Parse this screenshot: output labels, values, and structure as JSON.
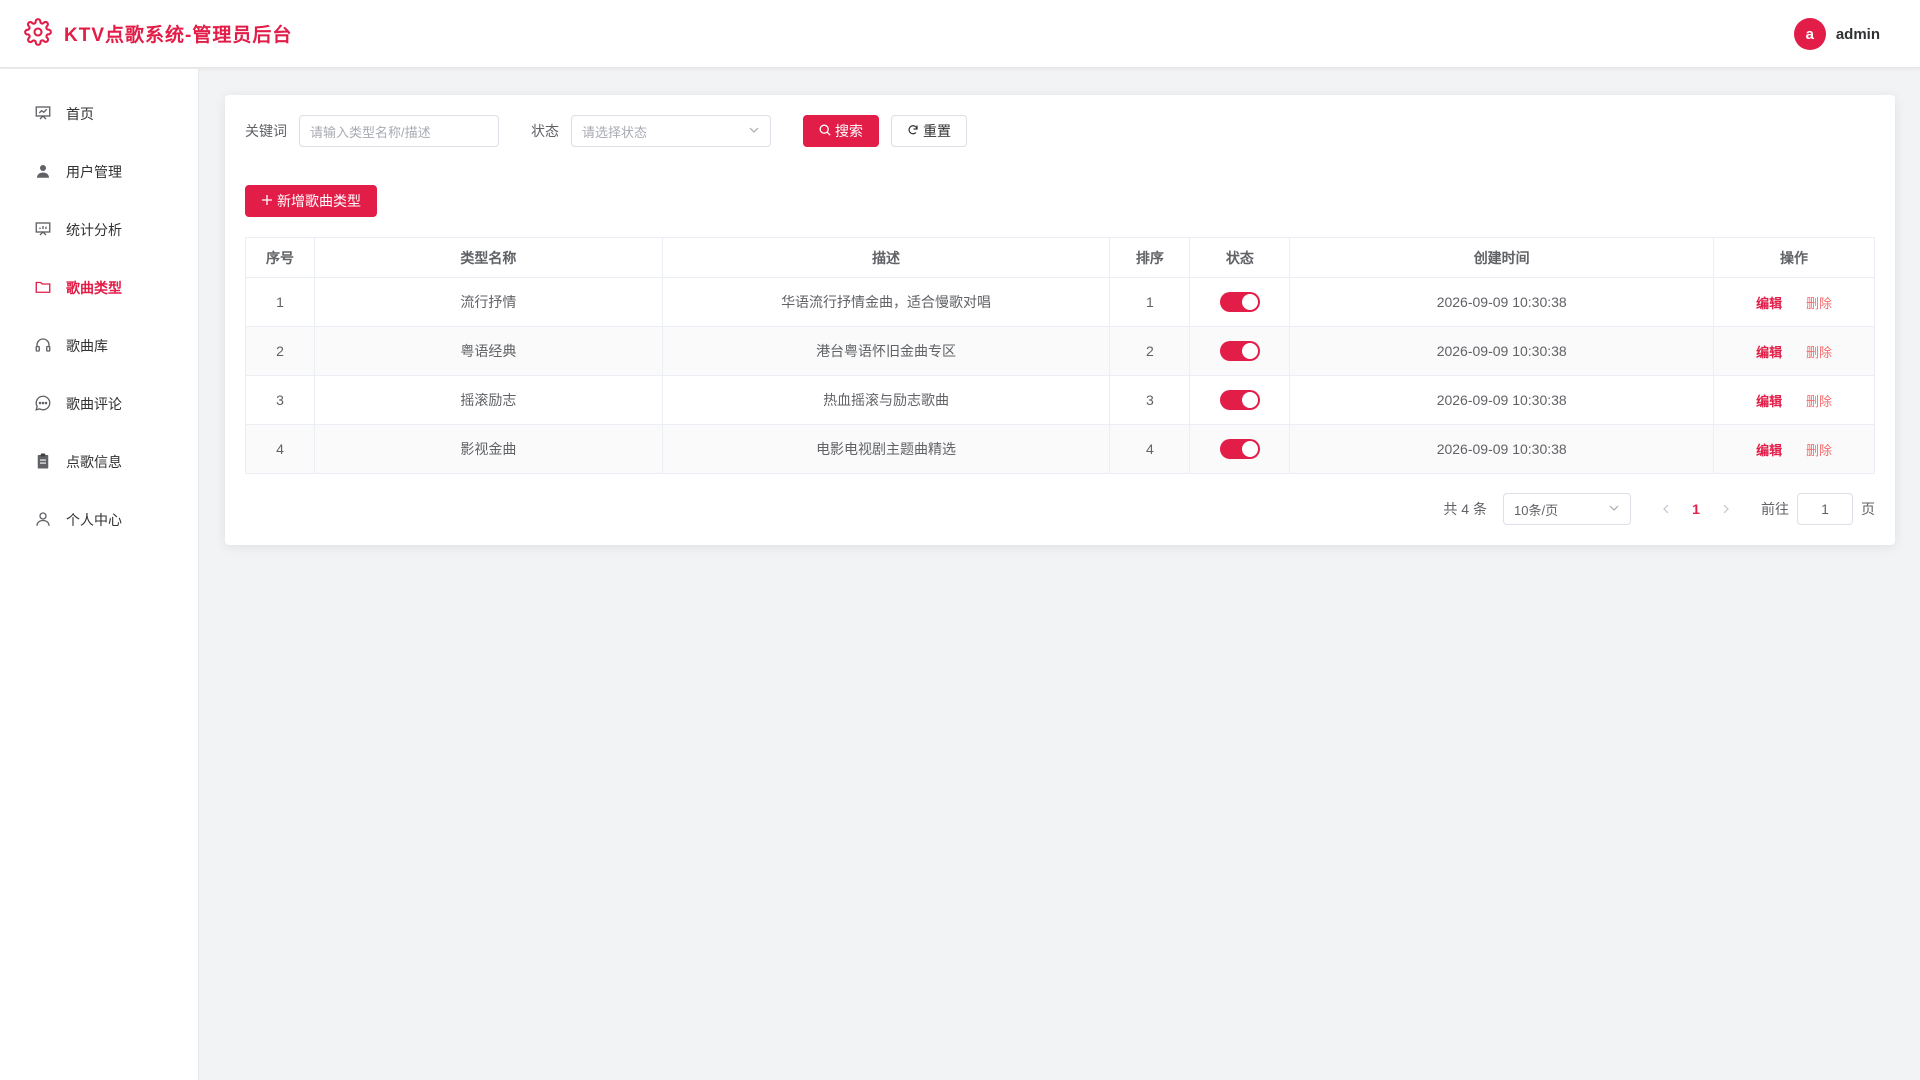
{
  "header": {
    "title": "KTV点歌系统-管理员后台",
    "user_initial": "a",
    "username": "admin"
  },
  "sidebar": {
    "items": [
      {
        "label": "首页",
        "icon": "dashboard-icon",
        "active": false
      },
      {
        "label": "用户管理",
        "icon": "user-icon",
        "active": false
      },
      {
        "label": "统计分析",
        "icon": "chart-icon",
        "active": false
      },
      {
        "label": "歌曲类型",
        "icon": "folder-icon",
        "active": true
      },
      {
        "label": "歌曲库",
        "icon": "headset-icon",
        "active": false
      },
      {
        "label": "歌曲评论",
        "icon": "chat-icon",
        "active": false
      },
      {
        "label": "点歌信息",
        "icon": "clipboard-icon",
        "active": false
      },
      {
        "label": "个人中心",
        "icon": "person-icon",
        "active": false
      }
    ]
  },
  "search": {
    "keyword_label": "关键词",
    "keyword_placeholder": "请输入类型名称/描述",
    "status_label": "状态",
    "status_placeholder": "请选择状态",
    "search_button": "搜索",
    "reset_button": "重置"
  },
  "add_button": "新增歌曲类型",
  "table": {
    "headers": [
      "序号",
      "类型名称",
      "描述",
      "排序",
      "状态",
      "创建时间",
      "操作"
    ],
    "rows": [
      {
        "index": "1",
        "name": "流行抒情",
        "desc": "华语流行抒情金曲，适合慢歌对唱",
        "sort": "1",
        "enabled": true,
        "created": "2026-09-09 10:30:38"
      },
      {
        "index": "2",
        "name": "粤语经典",
        "desc": "港台粤语怀旧金曲专区",
        "sort": "2",
        "enabled": true,
        "created": "2026-09-09 10:30:38"
      },
      {
        "index": "3",
        "name": "摇滚励志",
        "desc": "热血摇滚与励志歌曲",
        "sort": "3",
        "enabled": true,
        "created": "2026-09-09 10:30:38"
      },
      {
        "index": "4",
        "name": "影视金曲",
        "desc": "电影电视剧主题曲精选",
        "sort": "4",
        "enabled": true,
        "created": "2026-09-09 10:30:38"
      }
    ],
    "edit_label": "编辑",
    "delete_label": "删除"
  },
  "pagination": {
    "total_text": "共 4 条",
    "page_size": "10条/页",
    "current_page": "1",
    "goto_label": "前往",
    "goto_value": "1",
    "page_suffix": "页"
  },
  "colors": {
    "accent": "#e11d48",
    "danger": "#f56c6c"
  }
}
